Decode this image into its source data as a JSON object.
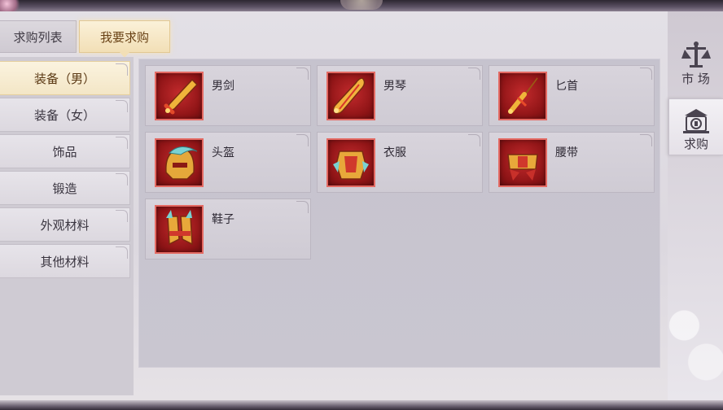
{
  "tabs": [
    {
      "label": "求购列表",
      "active": false
    },
    {
      "label": "我要求购",
      "active": true
    }
  ],
  "categories": [
    {
      "label": "装备（男）",
      "active": true
    },
    {
      "label": "装备（女）",
      "active": false
    },
    {
      "label": "饰品",
      "active": false
    },
    {
      "label": "锻造",
      "active": false
    },
    {
      "label": "外观材料",
      "active": false
    },
    {
      "label": "其他材料",
      "active": false
    }
  ],
  "items": [
    {
      "name": "男剑",
      "icon": "sword-icon"
    },
    {
      "name": "男琴",
      "icon": "guqin-icon"
    },
    {
      "name": "匕首",
      "icon": "dagger-icon"
    },
    {
      "name": "头盔",
      "icon": "helmet-icon"
    },
    {
      "name": "衣服",
      "icon": "armor-icon"
    },
    {
      "name": "腰带",
      "icon": "belt-icon"
    },
    {
      "name": "鞋子",
      "icon": "boots-icon"
    }
  ],
  "side_nav": [
    {
      "label": "市 场",
      "icon": "scale-icon",
      "active": false
    },
    {
      "label": "求购",
      "icon": "purchase-icon",
      "active": true
    }
  ],
  "colors": {
    "active_tab": "#f2dfb6",
    "item_icon_bg": "#c22a2c",
    "panel_bg": "#dcd8df"
  }
}
